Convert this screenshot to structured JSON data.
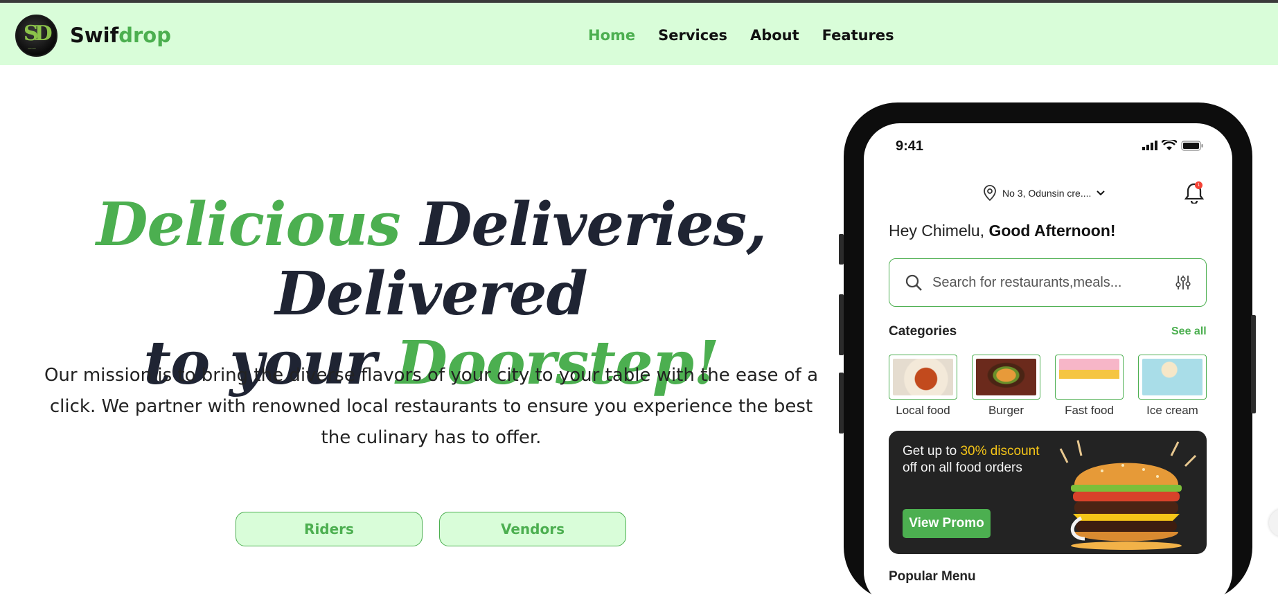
{
  "nav": {
    "brand_prefix": "Swif",
    "brand_suffix": "drop",
    "logo_monogram": "SD",
    "links": [
      {
        "label": "Home",
        "active": true
      },
      {
        "label": "Services",
        "active": false
      },
      {
        "label": "About",
        "active": false
      },
      {
        "label": "Features",
        "active": false
      }
    ]
  },
  "hero": {
    "title_part1": "Delicious",
    "title_part2": " Deliveries, Delivered",
    "title_part3": "to your ",
    "title_part4": "Doorstep!",
    "mission": "Our mission is to bring the diverse flavors of your city to your table with the ease of a click. We partner with renowned local restaurants to ensure you experience the best the culinary has to offer.",
    "buttons": {
      "riders": "Riders",
      "vendors": "Vendors"
    }
  },
  "phone": {
    "status_time": "9:41",
    "location": "No 3, Odunsin cre....",
    "notification_count": "1",
    "greeting_prefix": "Hey Chimelu, ",
    "greeting_bold": "Good Afternoon!",
    "search_placeholder": "Search for restaurants,meals...",
    "categories_title": "Categories",
    "see_all": "See all",
    "categories": [
      {
        "label": "Local food",
        "color": "#e8e0d4"
      },
      {
        "label": "Burger",
        "color": "#6b2a1c"
      },
      {
        "label": "Fast food",
        "color": "#f7b6c8"
      },
      {
        "label": "Ice cream",
        "color": "#a9dde8"
      }
    ],
    "promo": {
      "line1": "Get up to ",
      "highlight": "30% discount",
      "line2": " off on all food orders",
      "button": "View Promo"
    },
    "peek_text": "Popular Menu"
  },
  "colors": {
    "accent": "#4caf50",
    "nav_bg": "#d9fdd9",
    "dark_text": "#1f2433",
    "promo_bg": "#232323",
    "highlight": "#f5c518"
  }
}
